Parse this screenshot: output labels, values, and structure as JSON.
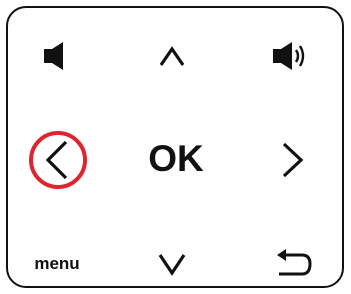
{
  "remote": {
    "ok_label": "OK",
    "menu_label": "menu",
    "highlight_color": "#e0242f",
    "icon_color": "#111111",
    "buttons": [
      {
        "name": "volume-down-button",
        "icon": "speaker-icon"
      },
      {
        "name": "up-button",
        "icon": "chevron-up-icon"
      },
      {
        "name": "volume-up-button",
        "icon": "speaker-loud-icon"
      },
      {
        "name": "left-button",
        "icon": "chevron-left-icon",
        "highlighted": true
      },
      {
        "name": "ok-button"
      },
      {
        "name": "right-button",
        "icon": "chevron-right-icon"
      },
      {
        "name": "menu-button"
      },
      {
        "name": "down-button",
        "icon": "chevron-down-icon"
      },
      {
        "name": "back-button",
        "icon": "return-arrow-icon"
      }
    ]
  }
}
